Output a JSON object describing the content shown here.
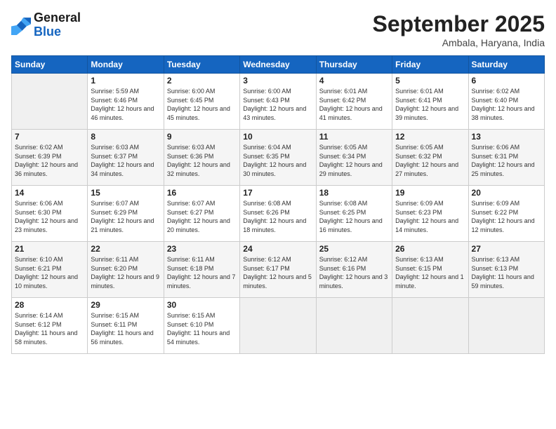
{
  "header": {
    "logo_line1": "General",
    "logo_line2": "Blue",
    "month": "September 2025",
    "location": "Ambala, Haryana, India"
  },
  "weekdays": [
    "Sunday",
    "Monday",
    "Tuesday",
    "Wednesday",
    "Thursday",
    "Friday",
    "Saturday"
  ],
  "weeks": [
    [
      {
        "day": "",
        "sunrise": "",
        "sunset": "",
        "daylight": ""
      },
      {
        "day": "1",
        "sunrise": "Sunrise: 5:59 AM",
        "sunset": "Sunset: 6:46 PM",
        "daylight": "Daylight: 12 hours and 46 minutes."
      },
      {
        "day": "2",
        "sunrise": "Sunrise: 6:00 AM",
        "sunset": "Sunset: 6:45 PM",
        "daylight": "Daylight: 12 hours and 45 minutes."
      },
      {
        "day": "3",
        "sunrise": "Sunrise: 6:00 AM",
        "sunset": "Sunset: 6:43 PM",
        "daylight": "Daylight: 12 hours and 43 minutes."
      },
      {
        "day": "4",
        "sunrise": "Sunrise: 6:01 AM",
        "sunset": "Sunset: 6:42 PM",
        "daylight": "Daylight: 12 hours and 41 minutes."
      },
      {
        "day": "5",
        "sunrise": "Sunrise: 6:01 AM",
        "sunset": "Sunset: 6:41 PM",
        "daylight": "Daylight: 12 hours and 39 minutes."
      },
      {
        "day": "6",
        "sunrise": "Sunrise: 6:02 AM",
        "sunset": "Sunset: 6:40 PM",
        "daylight": "Daylight: 12 hours and 38 minutes."
      }
    ],
    [
      {
        "day": "7",
        "sunrise": "Sunrise: 6:02 AM",
        "sunset": "Sunset: 6:39 PM",
        "daylight": "Daylight: 12 hours and 36 minutes."
      },
      {
        "day": "8",
        "sunrise": "Sunrise: 6:03 AM",
        "sunset": "Sunset: 6:37 PM",
        "daylight": "Daylight: 12 hours and 34 minutes."
      },
      {
        "day": "9",
        "sunrise": "Sunrise: 6:03 AM",
        "sunset": "Sunset: 6:36 PM",
        "daylight": "Daylight: 12 hours and 32 minutes."
      },
      {
        "day": "10",
        "sunrise": "Sunrise: 6:04 AM",
        "sunset": "Sunset: 6:35 PM",
        "daylight": "Daylight: 12 hours and 30 minutes."
      },
      {
        "day": "11",
        "sunrise": "Sunrise: 6:05 AM",
        "sunset": "Sunset: 6:34 PM",
        "daylight": "Daylight: 12 hours and 29 minutes."
      },
      {
        "day": "12",
        "sunrise": "Sunrise: 6:05 AM",
        "sunset": "Sunset: 6:32 PM",
        "daylight": "Daylight: 12 hours and 27 minutes."
      },
      {
        "day": "13",
        "sunrise": "Sunrise: 6:06 AM",
        "sunset": "Sunset: 6:31 PM",
        "daylight": "Daylight: 12 hours and 25 minutes."
      }
    ],
    [
      {
        "day": "14",
        "sunrise": "Sunrise: 6:06 AM",
        "sunset": "Sunset: 6:30 PM",
        "daylight": "Daylight: 12 hours and 23 minutes."
      },
      {
        "day": "15",
        "sunrise": "Sunrise: 6:07 AM",
        "sunset": "Sunset: 6:29 PM",
        "daylight": "Daylight: 12 hours and 21 minutes."
      },
      {
        "day": "16",
        "sunrise": "Sunrise: 6:07 AM",
        "sunset": "Sunset: 6:27 PM",
        "daylight": "Daylight: 12 hours and 20 minutes."
      },
      {
        "day": "17",
        "sunrise": "Sunrise: 6:08 AM",
        "sunset": "Sunset: 6:26 PM",
        "daylight": "Daylight: 12 hours and 18 minutes."
      },
      {
        "day": "18",
        "sunrise": "Sunrise: 6:08 AM",
        "sunset": "Sunset: 6:25 PM",
        "daylight": "Daylight: 12 hours and 16 minutes."
      },
      {
        "day": "19",
        "sunrise": "Sunrise: 6:09 AM",
        "sunset": "Sunset: 6:23 PM",
        "daylight": "Daylight: 12 hours and 14 minutes."
      },
      {
        "day": "20",
        "sunrise": "Sunrise: 6:09 AM",
        "sunset": "Sunset: 6:22 PM",
        "daylight": "Daylight: 12 hours and 12 minutes."
      }
    ],
    [
      {
        "day": "21",
        "sunrise": "Sunrise: 6:10 AM",
        "sunset": "Sunset: 6:21 PM",
        "daylight": "Daylight: 12 hours and 10 minutes."
      },
      {
        "day": "22",
        "sunrise": "Sunrise: 6:11 AM",
        "sunset": "Sunset: 6:20 PM",
        "daylight": "Daylight: 12 hours and 9 minutes."
      },
      {
        "day": "23",
        "sunrise": "Sunrise: 6:11 AM",
        "sunset": "Sunset: 6:18 PM",
        "daylight": "Daylight: 12 hours and 7 minutes."
      },
      {
        "day": "24",
        "sunrise": "Sunrise: 6:12 AM",
        "sunset": "Sunset: 6:17 PM",
        "daylight": "Daylight: 12 hours and 5 minutes."
      },
      {
        "day": "25",
        "sunrise": "Sunrise: 6:12 AM",
        "sunset": "Sunset: 6:16 PM",
        "daylight": "Daylight: 12 hours and 3 minutes."
      },
      {
        "day": "26",
        "sunrise": "Sunrise: 6:13 AM",
        "sunset": "Sunset: 6:15 PM",
        "daylight": "Daylight: 12 hours and 1 minute."
      },
      {
        "day": "27",
        "sunrise": "Sunrise: 6:13 AM",
        "sunset": "Sunset: 6:13 PM",
        "daylight": "Daylight: 11 hours and 59 minutes."
      }
    ],
    [
      {
        "day": "28",
        "sunrise": "Sunrise: 6:14 AM",
        "sunset": "Sunset: 6:12 PM",
        "daylight": "Daylight: 11 hours and 58 minutes."
      },
      {
        "day": "29",
        "sunrise": "Sunrise: 6:15 AM",
        "sunset": "Sunset: 6:11 PM",
        "daylight": "Daylight: 11 hours and 56 minutes."
      },
      {
        "day": "30",
        "sunrise": "Sunrise: 6:15 AM",
        "sunset": "Sunset: 6:10 PM",
        "daylight": "Daylight: 11 hours and 54 minutes."
      },
      {
        "day": "",
        "sunrise": "",
        "sunset": "",
        "daylight": ""
      },
      {
        "day": "",
        "sunrise": "",
        "sunset": "",
        "daylight": ""
      },
      {
        "day": "",
        "sunrise": "",
        "sunset": "",
        "daylight": ""
      },
      {
        "day": "",
        "sunrise": "",
        "sunset": "",
        "daylight": ""
      }
    ]
  ]
}
